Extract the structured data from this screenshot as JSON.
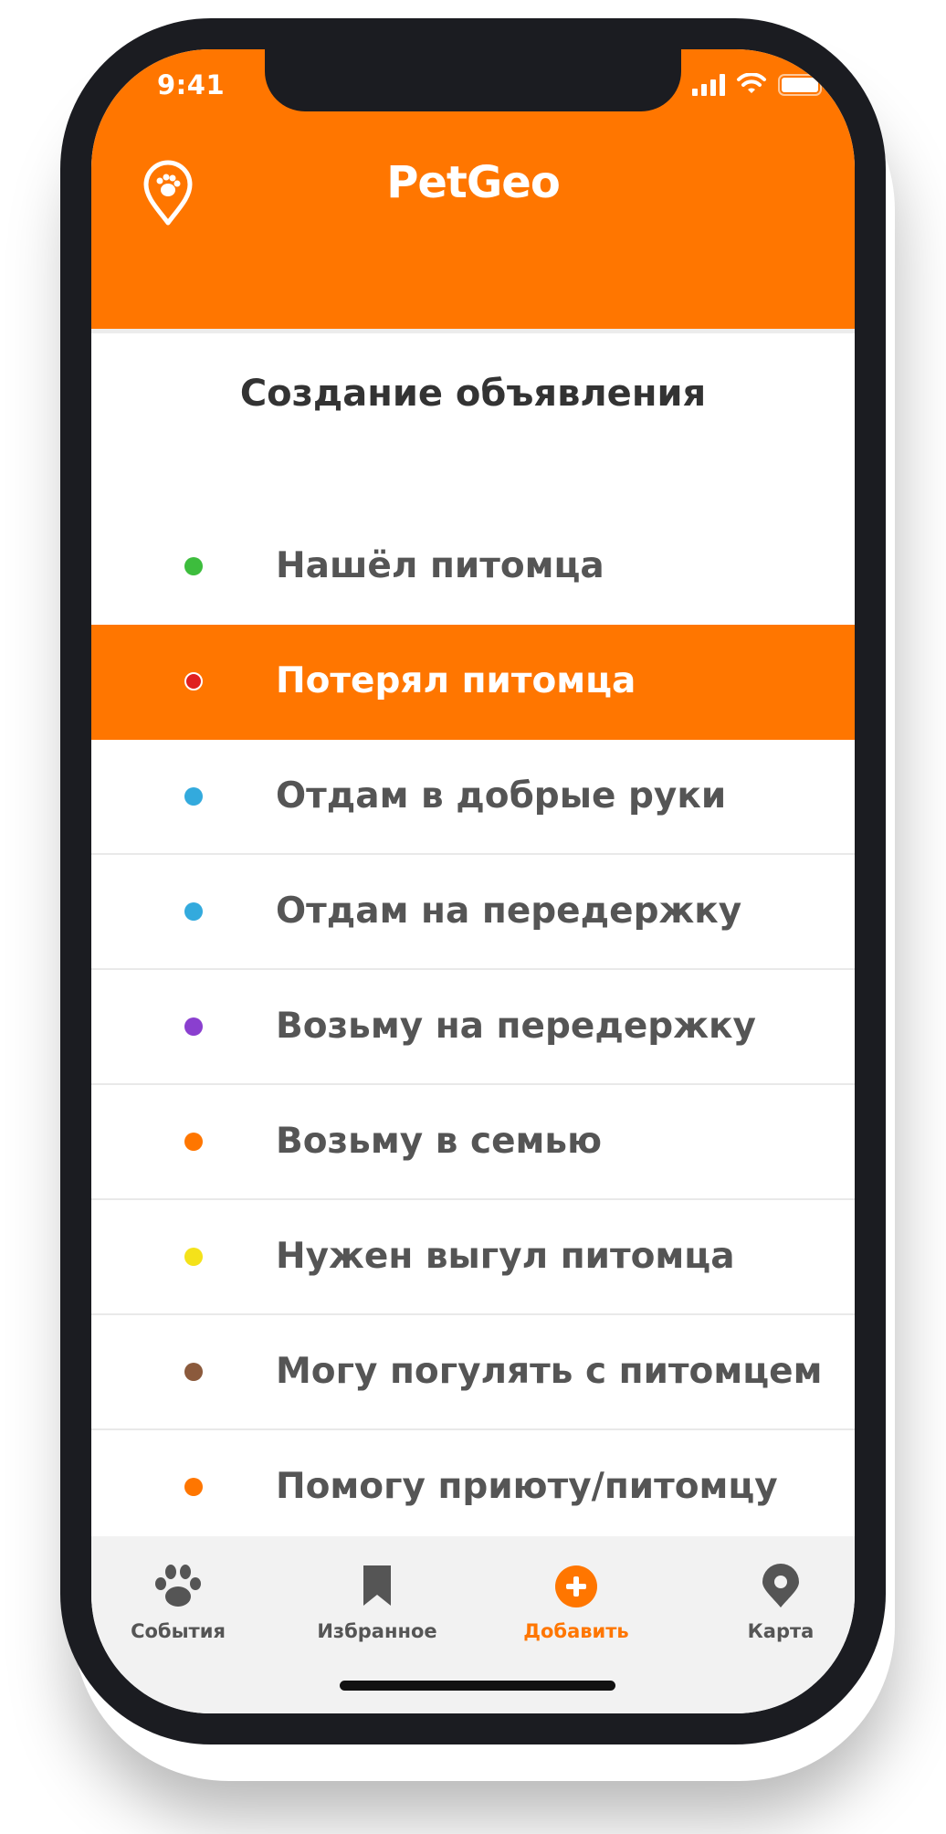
{
  "status_bar": {
    "time": "9:41",
    "icons": [
      "signal-icon",
      "wifi-icon",
      "battery-icon"
    ]
  },
  "header": {
    "app_title": "PetGeo",
    "logo_icon": "paw-pin-icon",
    "background_color": "#ff7600"
  },
  "page_title": "Создание объявления",
  "menu": {
    "items": [
      {
        "label": "Нашёл питомца",
        "dot_color": "#3dbd3d",
        "selected": false
      },
      {
        "label": "Потерял питомца",
        "dot_color": "#e02020",
        "selected": true
      },
      {
        "label": "Отдам в добрые руки",
        "dot_color": "#33aadd",
        "selected": false
      },
      {
        "label": "Отдам на передержку",
        "dot_color": "#33aadd",
        "selected": false
      },
      {
        "label": "Возьму на передержку",
        "dot_color": "#8a3fcf",
        "selected": false
      },
      {
        "label": "Возьму в семью",
        "dot_color": "#ff7600",
        "selected": false
      },
      {
        "label": "Нужен выгул питомца",
        "dot_color": "#f4e21a",
        "selected": false
      },
      {
        "label": "Могу погулять с питомцем",
        "dot_color": "#8b5a3c",
        "selected": false
      },
      {
        "label": "Помогу приюту/питомцу",
        "dot_color": "#ff7600",
        "selected": false
      }
    ]
  },
  "tabbar": {
    "tabs": [
      {
        "label": "События",
        "icon": "paw-icon",
        "active": false
      },
      {
        "label": "Избранное",
        "icon": "bookmark-icon",
        "active": false
      },
      {
        "label": "Добавить",
        "icon": "plus-circle-icon",
        "active": true
      },
      {
        "label": "Карта",
        "icon": "map-pin-icon",
        "active": false
      }
    ],
    "active_color": "#ff7600"
  }
}
